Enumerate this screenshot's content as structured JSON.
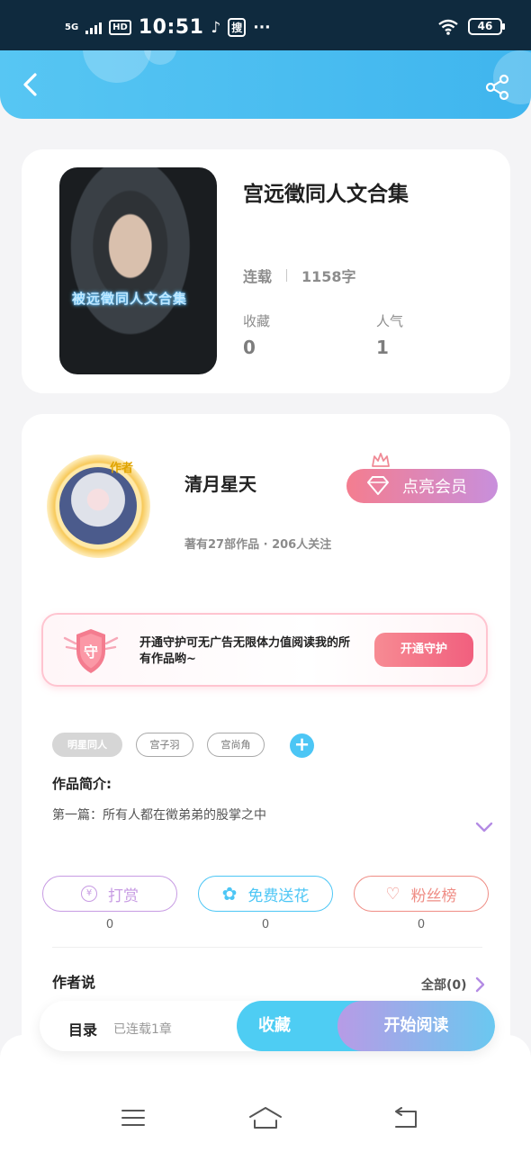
{
  "status_bar": {
    "network": "5G",
    "hd_badge": "HD",
    "time": "10:51",
    "search_glyph": "搜",
    "more": "···",
    "battery": "46"
  },
  "header": {
    "back_icon": "chevron-left-icon",
    "share_icon": "share-icon",
    "colors": {
      "background": "#4cbdf1"
    }
  },
  "book": {
    "title": "宫远徵同人文合集",
    "cover_caption": "被远徵同人文合集",
    "status": "连载",
    "word_count": "1158字",
    "favorites_label": "收藏",
    "favorites_value": "0",
    "popularity_label": "人气",
    "popularity_value": "1"
  },
  "author": {
    "badge": "作者",
    "name": "清月星天",
    "stats": "著有27部作品 · 206人关注",
    "vip_button": "点亮会员"
  },
  "guard": {
    "shield_glyph": "守",
    "text": "开通守护可无广告无限体力值阅读我的所有作品哟~",
    "button": "开通守护"
  },
  "tags": [
    "明星同人",
    "宫子羽",
    "宫尚角"
  ],
  "intro": {
    "heading": "作品简介:",
    "text": "第一篇：所有人都在徵弟弟的股掌之中"
  },
  "actions": [
    {
      "icon_glyph": "¥",
      "label": "打赏",
      "count": "0",
      "color": "#c79be3"
    },
    {
      "icon_glyph": "✿",
      "label": "免费送花",
      "count": "0",
      "color": "#4cc6f5"
    },
    {
      "icon_glyph": "♡",
      "label": "粉丝榜",
      "count": "0",
      "color": "#ef8d85"
    }
  ],
  "author_says": {
    "heading": "作者说",
    "view_all": "全部(0)"
  },
  "bottom_bar": {
    "toc": "目录",
    "toc_sub": "已连载1章",
    "collect": "收藏",
    "read": "开始阅读"
  },
  "nav": {
    "menu_icon": "menu-icon",
    "home_icon": "home-icon",
    "back_icon": "back-icon"
  }
}
